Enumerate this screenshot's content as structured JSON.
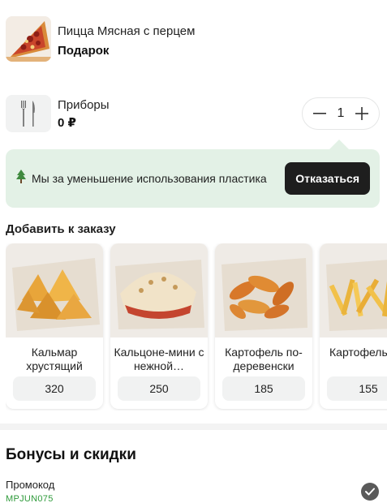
{
  "cart_items": [
    {
      "name": "Пицца Мясная с перцем",
      "subtitle": "Подарок",
      "image_icon": "pizza-slice-image"
    },
    {
      "name": "Приборы",
      "subtitle": "0 ₽",
      "image_icon": "fork-knife-icon",
      "quantity": "1"
    }
  ],
  "eco_banner": {
    "icon": "tree-icon",
    "text": "Мы за уменьшение использования пластика",
    "button_label": "Отказаться",
    "background_color": "#e3f1e6"
  },
  "add_to_order": {
    "title": "Добавить к заказу",
    "products": [
      {
        "name": "Кальмар хрустящий",
        "price": "320",
        "image": "fried-squid-image"
      },
      {
        "name": "Кальцоне-мини с нежной…",
        "price": "250",
        "image": "calzone-image"
      },
      {
        "name": "Картофель по-деревенски",
        "price": "185",
        "image": "potato-wedges-image"
      },
      {
        "name": "Картофель",
        "price": "155",
        "image": "french-fries-image"
      }
    ]
  },
  "bonuses": {
    "title": "Бонусы и скидки",
    "promo_label": "Промокод",
    "promo_code": "MPJUN075",
    "promo_code_color": "#2e9a3a"
  }
}
